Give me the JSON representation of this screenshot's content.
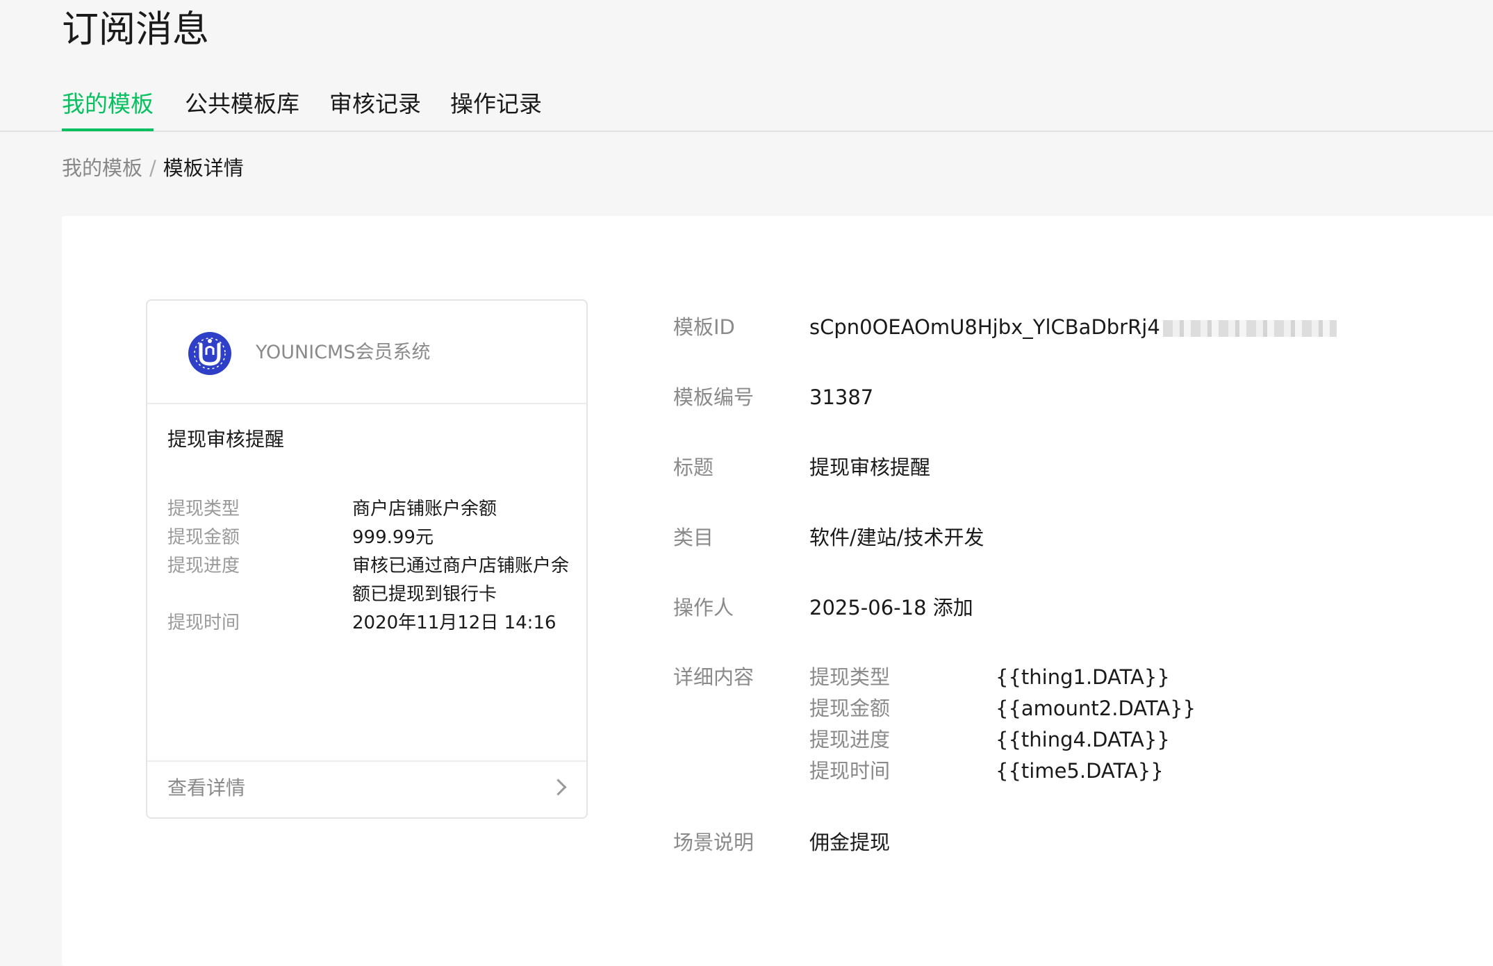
{
  "page": {
    "title": "订阅消息"
  },
  "tabs": [
    {
      "label": "我的模板",
      "active": true
    },
    {
      "label": "公共模板库",
      "active": false
    },
    {
      "label": "审核记录",
      "active": false
    },
    {
      "label": "操作记录",
      "active": false
    }
  ],
  "breadcrumb": {
    "parent": "我的模板",
    "separator": "/",
    "current": "模板详情"
  },
  "preview": {
    "app_name": "YOUNICMS会员系统",
    "logo_icon": "younicms-logo-icon",
    "message_title": "提现审核提醒",
    "fields": [
      {
        "key": "提现类型",
        "value": "商户店铺账户余额"
      },
      {
        "key": "提现金额",
        "value": "999.99元"
      },
      {
        "key": "提现进度",
        "value": "审核已通过商户店铺账户余额已提现到银行卡"
      },
      {
        "key": "提现时间",
        "value": "2020年11月12日 14:16"
      }
    ],
    "footer_label": "查看详情",
    "footer_icon": "chevron-right-icon"
  },
  "info": {
    "template_id_label": "模板ID",
    "template_id_value": "sCpn0OEAOmU8Hjbx_YlCBaDbrRj4",
    "template_no_label": "模板编号",
    "template_no_value": "31387",
    "title_label": "标题",
    "title_value": "提现审核提醒",
    "category_label": "类目",
    "category_value": "软件/建站/技术开发",
    "operator_label": "操作人",
    "operator_value": "2025-06-18 添加",
    "detail_label": "详细内容",
    "details": [
      {
        "key": "提现类型",
        "value": "{{thing1.DATA}}"
      },
      {
        "key": "提现金额",
        "value": "{{amount2.DATA}}"
      },
      {
        "key": "提现进度",
        "value": "{{thing4.DATA}}"
      },
      {
        "key": "提现时间",
        "value": "{{time5.DATA}}"
      }
    ],
    "scene_label": "场景说明",
    "scene_value": "佣金提现"
  },
  "colors": {
    "accent": "#07c160",
    "logo_blue": "#2f3fc8",
    "background": "#f6f6f6"
  }
}
